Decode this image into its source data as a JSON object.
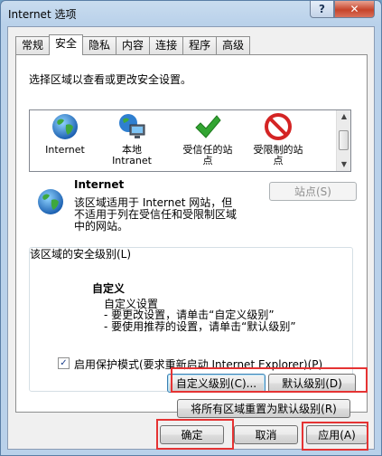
{
  "window": {
    "title": "Internet 选项",
    "help_label": "?",
    "close_label": "✕"
  },
  "tabs": [
    "常规",
    "安全",
    "隐私",
    "内容",
    "连接",
    "程序",
    "高级"
  ],
  "security": {
    "instruction": "选择区域以查看或更改安全设置。",
    "zones": [
      {
        "label": "Internet",
        "icon": "globe-icon"
      },
      {
        "label": "本地\nIntranet",
        "icon": "intranet-icon"
      },
      {
        "label": "受信任的站\n点",
        "icon": "checkmark-icon"
      },
      {
        "label": "受限制的站\n点",
        "icon": "restricted-icon"
      }
    ],
    "zone_name": "Internet",
    "zone_desc_1": "该区域适用于 Internet 网站，但",
    "zone_desc_2": "不适用于列在受信任和受限制区域",
    "zone_desc_3": "中的网站。",
    "sites_button": "站点(S)",
    "level_group_title": "该区域的安全级别(L)",
    "level_name": "自定义",
    "level_line_1": "自定义设置",
    "level_line_2": "- 要更改设置，请单击“自定义级别”",
    "level_line_3": "- 要使用推荐的设置，请单击“默认级别”",
    "protected_mode_label": "启用保护模式(要求重新启动 Internet Explorer)(P)",
    "protected_mode_checked": true,
    "custom_level_button": "自定义级别(C)...",
    "default_level_button": "默认级别(D)",
    "reset_all_button": "将所有区域重置为默认级别(R)"
  },
  "footer": {
    "ok": "确定",
    "cancel": "取消",
    "apply": "应用(A)"
  },
  "colors": {
    "highlight_box": "#e53333",
    "titlebar": "#b9d1ea",
    "close": "#c6442b"
  }
}
